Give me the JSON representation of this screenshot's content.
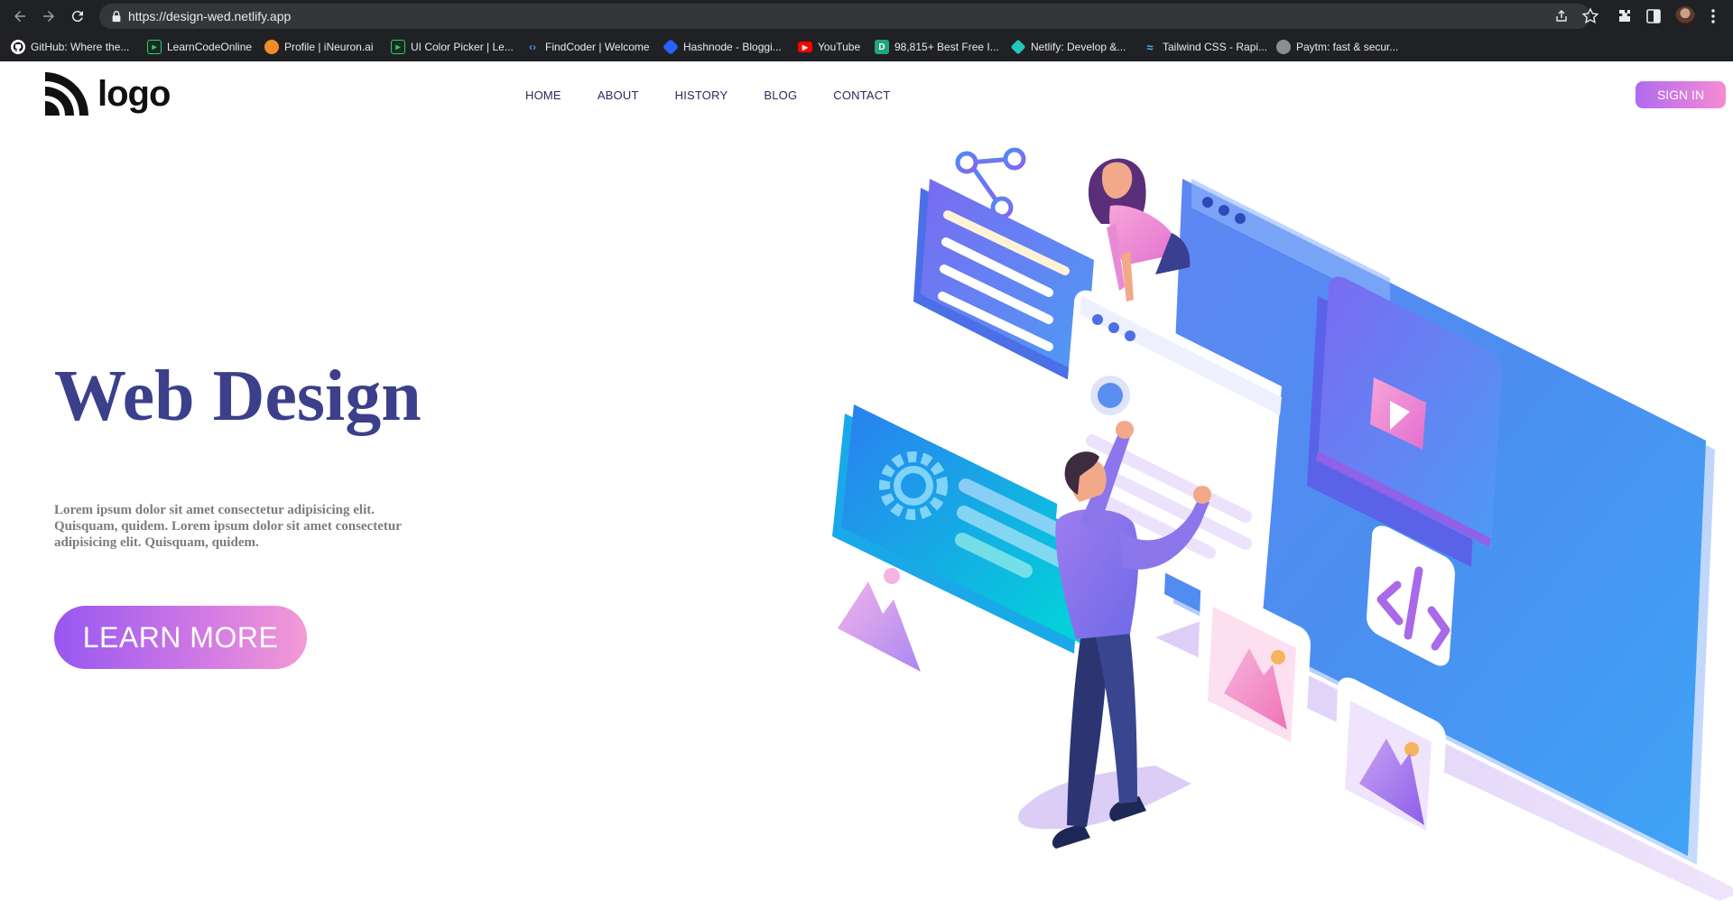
{
  "browser": {
    "url": "https://design-wed.netlify.app",
    "bookmarks": [
      {
        "label": "GitHub: Where the...",
        "icon": "github-icon"
      },
      {
        "label": "LearnCodeOnline",
        "icon": "lco-icon"
      },
      {
        "label": "Profile | iNeuron.ai",
        "icon": "ineuron-icon"
      },
      {
        "label": "UI Color Picker | Le...",
        "icon": "lco-icon"
      },
      {
        "label": "FindCoder | Welcome",
        "icon": "code-icon"
      },
      {
        "label": "Hashnode - Bloggi...",
        "icon": "hashnode-icon"
      },
      {
        "label": "YouTube",
        "icon": "youtube-icon"
      },
      {
        "label": "98,815+ Best Free I...",
        "icon": "freepik-icon"
      },
      {
        "label": "Netlify: Develop &...",
        "icon": "netlify-icon"
      },
      {
        "label": "Tailwind CSS - Rapi...",
        "icon": "tailwind-icon"
      },
      {
        "label": "Paytm: fast & secur...",
        "icon": "globe-icon"
      }
    ]
  },
  "header": {
    "logo_text": "logo",
    "nav": [
      "HOME",
      "ABOUT",
      "HISTORY",
      "BLOG",
      "CONTACT"
    ],
    "signin_label": "SIGN IN"
  },
  "hero": {
    "title": "Web Design",
    "text": "Lorem ipsum dolor sit amet consectetur adipisicing elit. Quisquam, quidem. Lorem ipsum dolor sit amet consectetur adipisicing elit. Quisquam, quidem.",
    "cta_label": "LEARN MORE"
  },
  "colors": {
    "chrome_bg": "#202124",
    "title": "#3c3f8a",
    "nav_text": "#2b2a5a",
    "gradient_start": "#9757f0",
    "gradient_end": "#f39ad6"
  }
}
